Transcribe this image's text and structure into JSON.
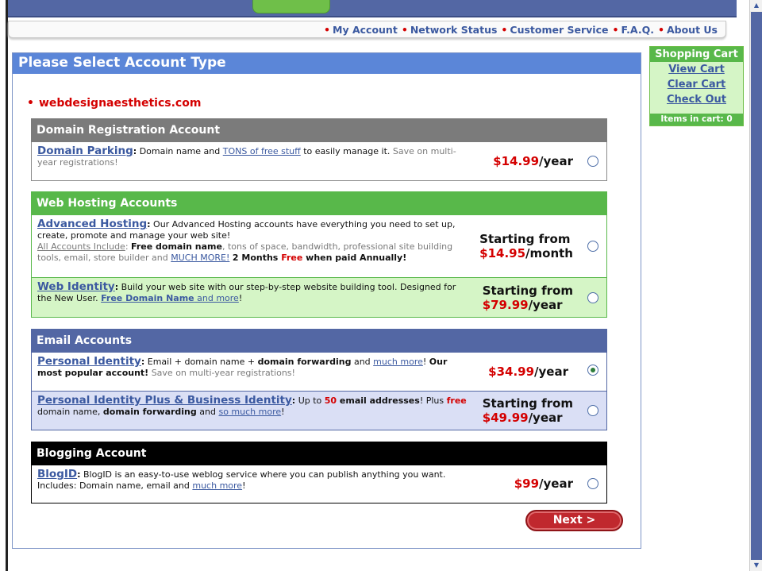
{
  "top_nav": [
    "My Account",
    "Network Status",
    "Customer Service",
    "F.A.Q.",
    "About Us"
  ],
  "panel": {
    "title": "Please Select Account Type",
    "domain": "webdesignaesthetics.com"
  },
  "sections": {
    "domain": {
      "header": "Domain Registration Account",
      "parking": {
        "title": "Domain Parking",
        "text1": "Domain name and ",
        "link": "TONS of free stuff",
        "text2": " to easily manage it.",
        "note": " Save on multi-year registrations!",
        "price": "$14.99",
        "unit": "/year"
      }
    },
    "web": {
      "header": "Web Hosting Accounts",
      "advanced": {
        "title": "Advanced Hosting",
        "text1": "Our Advanced Hosting accounts have everything you need to set up, create, promote and manage your web site!",
        "include_label": "All Accounts Include",
        "bold1": "Free domain name",
        "text2": ", tons of space, bandwidth, professional site building tools, email, store builder and ",
        "link": "MUCH MORE!",
        "bold2a": "2 Months ",
        "bold2b": "Free",
        "bold2c": " when paid Annually!",
        "starting": "Starting from",
        "price": "$14.95",
        "unit": "/month"
      },
      "identity": {
        "title": "Web Identity",
        "text1": "Build your web site with our step-by-step website building tool. Designed for the New User. ",
        "link1": "Free Domain Name",
        "link2": " and more",
        "text2": "!",
        "starting": "Starting from",
        "price": "$79.99",
        "unit": "/year"
      }
    },
    "email": {
      "header": "Email Accounts",
      "personal": {
        "title": "Personal Identity",
        "text1": "Email + domain name + ",
        "bold1": "domain forwarding",
        "text2": " and ",
        "link": "much more",
        "text3": "! ",
        "bold2": "Our most popular account!",
        "note": " Save on multi-year registrations!",
        "price": "$34.99",
        "unit": "/year"
      },
      "plus": {
        "title": "Personal Identity Plus & Business Identity",
        "text1": "Up to ",
        "count": "50",
        "bold1": " email addresses",
        "text2": "! Plus ",
        "free": "free",
        "text3": " domain name, ",
        "bold2": "domain forwarding",
        "text4": " and ",
        "link": "so much more",
        "text5": "!",
        "starting": "Starting from",
        "price": "$49.99",
        "unit": "/year"
      }
    },
    "blog": {
      "header": "Blogging Account",
      "blogid": {
        "title": "BlogID",
        "text1": "BlogID is an easy-to-use weblog service where you can publish anything you want. Includes: Domain name, email and ",
        "link": "much more",
        "text2": "!",
        "price": "$99",
        "unit": "/year"
      }
    }
  },
  "next_button": "Next >",
  "cart": {
    "title": "Shopping Cart",
    "view": "View Cart",
    "clear": "Clear Cart",
    "checkout": "Check Out",
    "items": "Items in cart: 0"
  },
  "selected_option": "personal-identity"
}
